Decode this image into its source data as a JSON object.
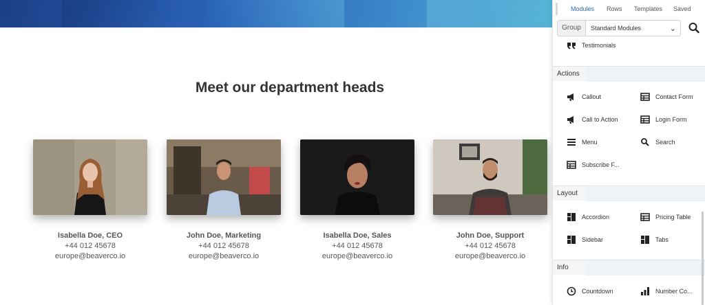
{
  "main": {
    "heading": "Meet our department heads",
    "members": [
      {
        "name": "Isabella Doe, CEO",
        "phone": "+44 012 45678",
        "email": "europe@beaverco.io"
      },
      {
        "name": "John Doe, Marketing",
        "phone": "+44 012 45678",
        "email": "europe@beaverco.io"
      },
      {
        "name": "Isabella Doe, Sales",
        "phone": "+44 012 45678",
        "email": "europe@beaverco.io"
      },
      {
        "name": "John Doe, Support",
        "phone": "+44 012 45678",
        "email": "europe@beaverco.io"
      }
    ]
  },
  "panel": {
    "tabs": [
      {
        "label": "Modules",
        "active": true
      },
      {
        "label": "Rows",
        "active": false
      },
      {
        "label": "Templates",
        "active": false
      },
      {
        "label": "Saved",
        "active": false
      }
    ],
    "group": {
      "label": "Group",
      "selected": "Standard Modules"
    },
    "top_module": {
      "label": "Testimonials",
      "icon": "quote-icon"
    },
    "sections": [
      {
        "title": "Actions",
        "modules": [
          {
            "label": "Callout",
            "icon": "megaphone-icon"
          },
          {
            "label": "Contact Form",
            "icon": "form-table-icon"
          },
          {
            "label": "Call to Action",
            "icon": "megaphone-icon"
          },
          {
            "label": "Login Form",
            "icon": "form-table-icon"
          },
          {
            "label": "Menu",
            "icon": "hamburger-icon"
          },
          {
            "label": "Search",
            "icon": "search-icon"
          },
          {
            "label": "Subscribe F...",
            "icon": "form-table-icon"
          }
        ]
      },
      {
        "title": "Layout",
        "modules": [
          {
            "label": "Accordion",
            "icon": "layout-grid-icon"
          },
          {
            "label": "Pricing Table",
            "icon": "form-table-icon"
          },
          {
            "label": "Sidebar",
            "icon": "layout-grid-icon"
          },
          {
            "label": "Tabs",
            "icon": "layout-grid-icon"
          }
        ]
      },
      {
        "title": "Info",
        "modules": [
          {
            "label": "Countdown",
            "icon": "clock-icon"
          },
          {
            "label": "Number Co...",
            "icon": "bar-chart-icon"
          }
        ]
      }
    ]
  },
  "colors": {
    "accent": "#2a6fc1",
    "hero_start": "#1c3f86",
    "hero_end": "#56b4d6"
  }
}
